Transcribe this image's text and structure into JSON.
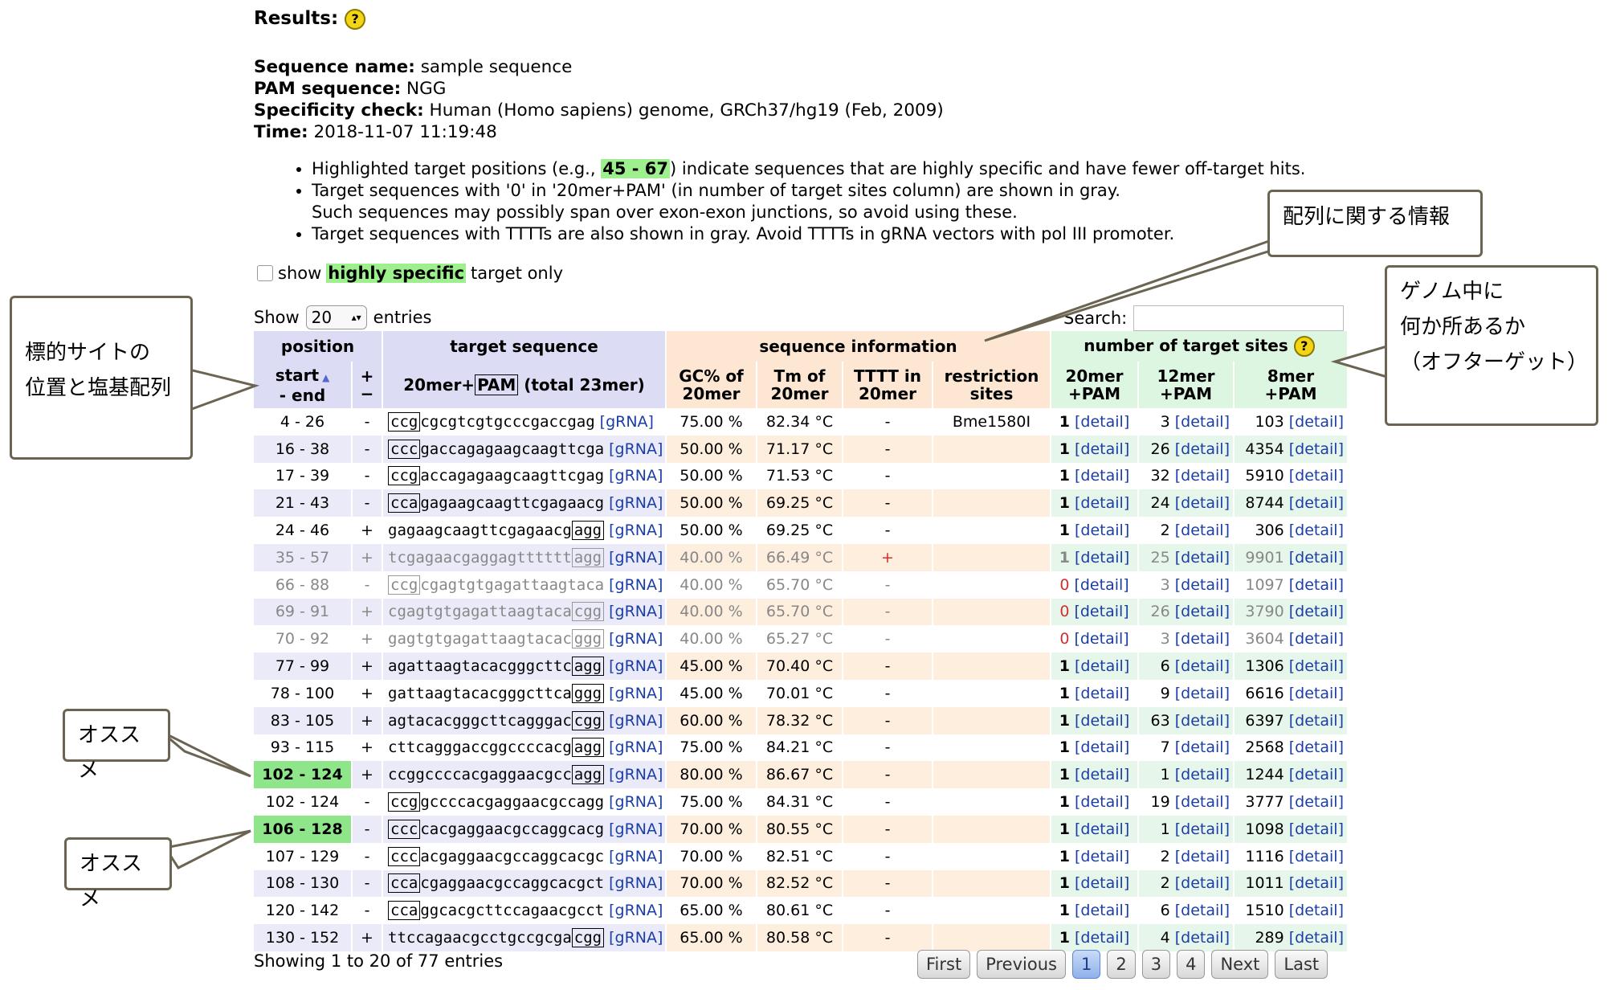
{
  "results_label": "Results:",
  "help_glyph": "?",
  "meta": {
    "seq_name_label": "Sequence name:",
    "seq_name": "sample sequence",
    "pam_label": "PAM sequence:",
    "pam": "NGG",
    "spec_label": "Specificity check:",
    "spec": "Human (Homo sapiens) genome, GRCh37/hg19 (Feb, 2009)",
    "time_label": "Time:",
    "time": "2018-11-07 11:19:48"
  },
  "notes": {
    "n1_pre": "Highlighted target positions (e.g., ",
    "n1_hl": "45 - 67",
    "n1_post": ") indicate sequences that are highly specific and have fewer off-target hits.",
    "n2a": "Target sequences with '0' in '20mer+PAM' (in number of target sites column) are shown in gray.",
    "n2b": "Such sequences may possibly span over exon-exon junctions, so avoid using these.",
    "n3": "Target sequences with TTTTs are also shown in gray. Avoid TTTTs in gRNA vectors with pol III promoter."
  },
  "filter": {
    "pre": "show",
    "hl": "highly specific",
    "post": "target only"
  },
  "show_entries": {
    "pre": "Show",
    "value": "20",
    "post": "entries"
  },
  "search_label": "Search:",
  "table": {
    "groups": {
      "position": "position",
      "target": "target sequence",
      "info": "sequence information",
      "num": "number of target sites"
    },
    "cols": {
      "start": "start",
      "end": "- end",
      "strand_top": "+",
      "strand_bot": "−",
      "target_pre": "20mer+",
      "target_pam": "PAM",
      "target_post": " (total 23mer)",
      "gc1": "GC% of",
      "gc2": "20mer",
      "tm1": "Tm of",
      "tm2": "20mer",
      "tt1": "TTTT in",
      "tt2": "20mer",
      "rs1": "restriction",
      "rs2": "sites",
      "n20a": "20mer",
      "n20b": "+PAM",
      "n12a": "12mer",
      "n12b": "+PAM",
      "n8a": "8mer",
      "n8b": "+PAM"
    },
    "grna_label": "[gRNA]",
    "detail_label": "[detail]",
    "rows": [
      {
        "pos": "4 - 26",
        "strand": "-",
        "pam": "ccg",
        "seq": "cgcgtcgtgcccgaccgag",
        "pam_first": true,
        "gc": "75.00 %",
        "tm": "82.34 °C",
        "tttt": "-",
        "rs": "Bme1580I",
        "n20": "1",
        "n12": "3",
        "n8": "103",
        "gray": false,
        "green": false
      },
      {
        "pos": "16 - 38",
        "strand": "-",
        "pam": "ccc",
        "seq": "gaccagagaagcaagttcga",
        "pam_first": true,
        "gc": "50.00 %",
        "tm": "71.17 °C",
        "tttt": "-",
        "rs": "",
        "n20": "1",
        "n12": "26",
        "n8": "4354",
        "gray": false,
        "green": false
      },
      {
        "pos": "17 - 39",
        "strand": "-",
        "pam": "ccg",
        "seq": "accagagaagcaagttcgag",
        "pam_first": true,
        "gc": "50.00 %",
        "tm": "71.53 °C",
        "tttt": "-",
        "rs": "",
        "n20": "1",
        "n12": "32",
        "n8": "5910",
        "gray": false,
        "green": false
      },
      {
        "pos": "21 - 43",
        "strand": "-",
        "pam": "cca",
        "seq": "gagaagcaagttcgagaacg",
        "pam_first": true,
        "gc": "50.00 %",
        "tm": "69.25 °C",
        "tttt": "-",
        "rs": "",
        "n20": "1",
        "n12": "24",
        "n8": "8744",
        "gray": false,
        "green": false
      },
      {
        "pos": "24 - 46",
        "strand": "+",
        "pam": "agg",
        "seq": "gagaagcaagttcgagaacg",
        "pam_first": false,
        "gc": "50.00 %",
        "tm": "69.25 °C",
        "tttt": "-",
        "rs": "",
        "n20": "1",
        "n12": "2",
        "n8": "306",
        "gray": false,
        "green": false
      },
      {
        "pos": "35 - 57",
        "strand": "+",
        "pam": "agg",
        "seq": "tcgagaacgaggagtttttt",
        "pam_first": false,
        "gc": "40.00 %",
        "tm": "66.49 °C",
        "tttt": "+",
        "rs": "",
        "n20": "1",
        "n12": "25",
        "n8": "9901",
        "gray": true,
        "green": false
      },
      {
        "pos": "66 - 88",
        "strand": "-",
        "pam": "ccg",
        "seq": "cgagtgtgagattaagtaca",
        "pam_first": true,
        "gc": "40.00 %",
        "tm": "65.70 °C",
        "tttt": "-",
        "rs": "",
        "n20": "0",
        "n12": "3",
        "n8": "1097",
        "gray": true,
        "green": false
      },
      {
        "pos": "69 - 91",
        "strand": "+",
        "pam": "cgg",
        "seq": "cgagtgtgagattaagtaca",
        "pam_first": false,
        "gc": "40.00 %",
        "tm": "65.70 °C",
        "tttt": "-",
        "rs": "",
        "n20": "0",
        "n12": "26",
        "n8": "3790",
        "gray": true,
        "green": false
      },
      {
        "pos": "70 - 92",
        "strand": "+",
        "pam": "ggg",
        "seq": "gagtgtgagattaagtacac",
        "pam_first": false,
        "gc": "40.00 %",
        "tm": "65.27 °C",
        "tttt": "-",
        "rs": "",
        "n20": "0",
        "n12": "3",
        "n8": "3604",
        "gray": true,
        "green": false
      },
      {
        "pos": "77 - 99",
        "strand": "+",
        "pam": "agg",
        "seq": "agattaagtacacgggcttc",
        "pam_first": false,
        "gc": "45.00 %",
        "tm": "70.40 °C",
        "tttt": "-",
        "rs": "",
        "n20": "1",
        "n12": "6",
        "n8": "1306",
        "gray": false,
        "green": false
      },
      {
        "pos": "78 - 100",
        "strand": "+",
        "pam": "ggg",
        "seq": "gattaagtacacgggcttca",
        "pam_first": false,
        "gc": "45.00 %",
        "tm": "70.01 °C",
        "tttt": "-",
        "rs": "",
        "n20": "1",
        "n12": "9",
        "n8": "6616",
        "gray": false,
        "green": false
      },
      {
        "pos": "83 - 105",
        "strand": "+",
        "pam": "cgg",
        "seq": "agtacacgggcttcagggac",
        "pam_first": false,
        "gc": "60.00 %",
        "tm": "78.32 °C",
        "tttt": "-",
        "rs": "",
        "n20": "1",
        "n12": "63",
        "n8": "6397",
        "gray": false,
        "green": false
      },
      {
        "pos": "93 - 115",
        "strand": "+",
        "pam": "agg",
        "seq": "cttcagggaccggccccacg",
        "pam_first": false,
        "gc": "75.00 %",
        "tm": "84.21 °C",
        "tttt": "-",
        "rs": "",
        "n20": "1",
        "n12": "7",
        "n8": "2568",
        "gray": false,
        "green": false
      },
      {
        "pos": "102 - 124",
        "strand": "+",
        "pam": "agg",
        "seq": "ccggccccacgaggaacgcc",
        "pam_first": false,
        "gc": "80.00 %",
        "tm": "86.67 °C",
        "tttt": "-",
        "rs": "",
        "n20": "1",
        "n12": "1",
        "n8": "1244",
        "gray": false,
        "green": true
      },
      {
        "pos": "102 - 124",
        "strand": "-",
        "pam": "ccg",
        "seq": "gccccacgaggaacgccagg",
        "pam_first": true,
        "gc": "75.00 %",
        "tm": "84.31 °C",
        "tttt": "-",
        "rs": "",
        "n20": "1",
        "n12": "19",
        "n8": "3777",
        "gray": false,
        "green": false
      },
      {
        "pos": "106 - 128",
        "strand": "-",
        "pam": "ccc",
        "seq": "cacgaggaacgccaggcacg",
        "pam_first": true,
        "gc": "70.00 %",
        "tm": "80.55 °C",
        "tttt": "-",
        "rs": "",
        "n20": "1",
        "n12": "1",
        "n8": "1098",
        "gray": false,
        "green": true
      },
      {
        "pos": "107 - 129",
        "strand": "-",
        "pam": "ccc",
        "seq": "acgaggaacgccaggcacgc",
        "pam_first": true,
        "gc": "70.00 %",
        "tm": "82.51 °C",
        "tttt": "-",
        "rs": "",
        "n20": "1",
        "n12": "2",
        "n8": "1116",
        "gray": false,
        "green": false
      },
      {
        "pos": "108 - 130",
        "strand": "-",
        "pam": "cca",
        "seq": "cgaggaacgccaggcacgct",
        "pam_first": true,
        "gc": "70.00 %",
        "tm": "82.52 °C",
        "tttt": "-",
        "rs": "",
        "n20": "1",
        "n12": "2",
        "n8": "1011",
        "gray": false,
        "green": false
      },
      {
        "pos": "120 - 142",
        "strand": "-",
        "pam": "cca",
        "seq": "ggcacgcttccagaacgcct",
        "pam_first": true,
        "gc": "65.00 %",
        "tm": "80.61 °C",
        "tttt": "-",
        "rs": "",
        "n20": "1",
        "n12": "6",
        "n8": "1510",
        "gray": false,
        "green": false
      },
      {
        "pos": "130 - 152",
        "strand": "+",
        "pam": "cgg",
        "seq": "ttccagaacgcctgccgcga",
        "pam_first": false,
        "gc": "65.00 %",
        "tm": "80.58 °C",
        "tttt": "-",
        "rs": "",
        "n20": "1",
        "n12": "4",
        "n8": "289",
        "gray": false,
        "green": false
      }
    ]
  },
  "showing": "Showing 1 to 20 of 77 entries",
  "pager": [
    "First",
    "Previous",
    "1",
    "2",
    "3",
    "4",
    "Next",
    "Last"
  ],
  "callouts": {
    "seq_info": "配列に関する情報",
    "genome_line1": "ゲノム中に",
    "genome_line2": "何か所あるか",
    "genome_line3": "（オフターゲット）",
    "pos_line1": "標的サイトの",
    "pos_line2": "位置と塩基配列",
    "rec1": "オススメ",
    "rec2": "オススメ"
  }
}
